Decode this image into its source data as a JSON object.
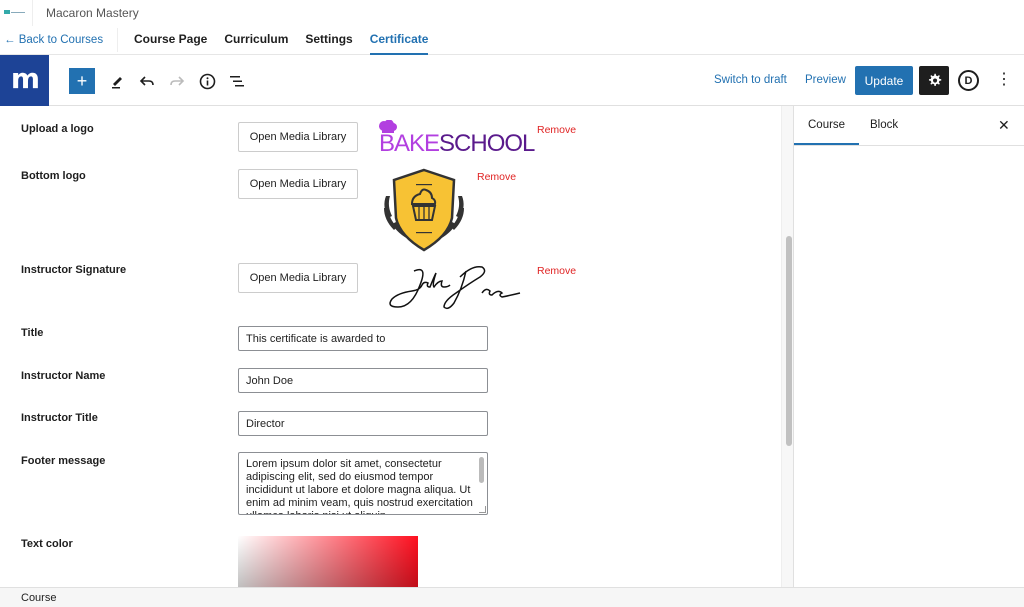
{
  "header": {
    "course_title": "Macaron Mastery",
    "back_link": "← Back to Courses",
    "tabs": [
      {
        "label": "Course Page",
        "active": false
      },
      {
        "label": "Curriculum",
        "active": false
      },
      {
        "label": "Settings",
        "active": false
      },
      {
        "label": "Certificate",
        "active": true
      }
    ]
  },
  "toolbar": {
    "brand_letter": "m",
    "add_icon": "+",
    "tools": [
      "add-block-icon",
      "pencil-icon",
      "undo-icon",
      "redo-icon",
      "info-icon",
      "list-view-icon"
    ],
    "switch_to_draft": "Switch to draft",
    "preview": "Preview",
    "update": "Update",
    "d_label": "D",
    "more": "⋮"
  },
  "form": {
    "upload_logo": {
      "label": "Upload a logo",
      "button": "Open Media Library",
      "remove": "Remove",
      "image_text_a": "BAKE",
      "image_text_b": "SCHOOL"
    },
    "bottom_logo": {
      "label": "Bottom logo",
      "button": "Open Media Library",
      "remove": "Remove"
    },
    "signature": {
      "label": "Instructor Signature",
      "button": "Open Media Library",
      "remove": "Remove",
      "signature_text": "John Doe"
    },
    "title": {
      "label": "Title",
      "value": "This certificate is awarded to"
    },
    "instructor_name": {
      "label": "Instructor Name",
      "value": "John Doe"
    },
    "instructor_title": {
      "label": "Instructor Title",
      "value": "Director"
    },
    "footer_message": {
      "label": "Footer message",
      "value": "Lorem ipsum dolor sit amet, consectetur adipiscing elit, sed do eiusmod tempor incididunt ut labore et dolore magna aliqua. Ut enim ad minim veam, quis nostrud exercitation ullamco laboris nisi ut aliquip"
    },
    "text_color": {
      "label": "Text color",
      "hue": "#ff1020"
    }
  },
  "sidebar": {
    "tabs": [
      {
        "label": "Course",
        "active": true
      },
      {
        "label": "Block",
        "active": false
      }
    ],
    "close": "✕"
  },
  "footer": {
    "breadcrumb": "Course"
  },
  "colors": {
    "accent": "#2271b1",
    "brand": "#1d4396",
    "remove": "#e02424",
    "logo_purple": "#b23fe0",
    "logo_dark": "#5a1a8c",
    "badge_gold": "#f7c234"
  }
}
